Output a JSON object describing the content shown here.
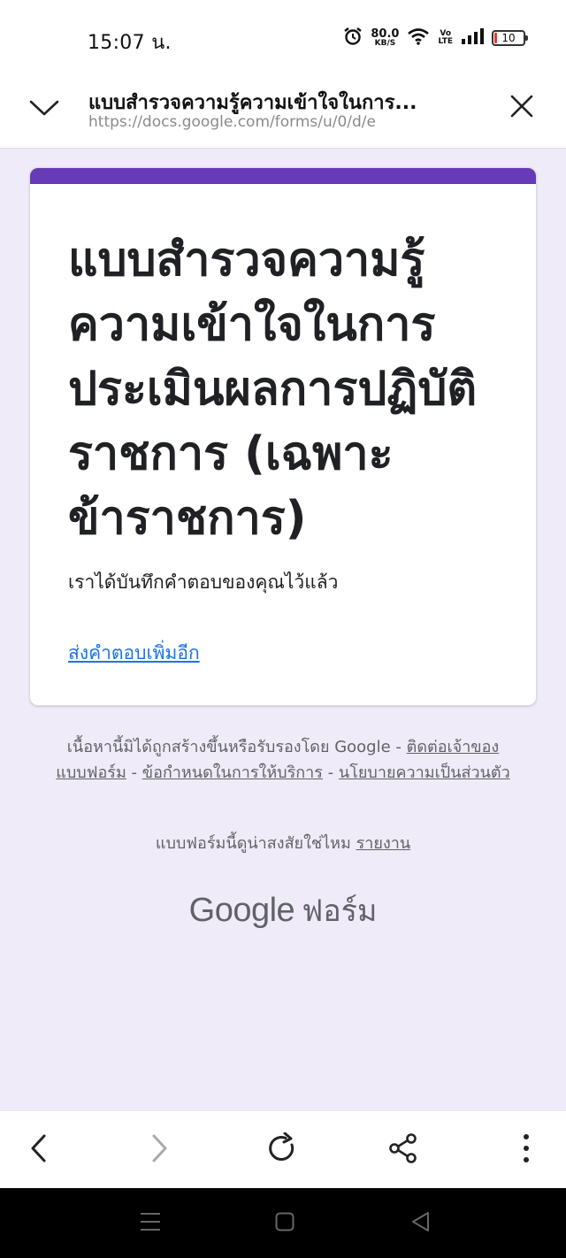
{
  "status_bar": {
    "time": "15:07 น.",
    "net_speed_value": "80.0",
    "net_speed_unit": "KB/S",
    "volte_top": "Vo",
    "volte_bottom": "LTE",
    "battery_level": "10",
    "icons": [
      "alarm-icon",
      "wifi-icon",
      "volte-icon",
      "signal-icon",
      "battery-icon"
    ]
  },
  "browser": {
    "title": "แบบสำรวจความรู้ความเข้าใจในการ...",
    "url": "https://docs.google.com/forms/u/0/d/e",
    "collapse_icon": "chevron-down-icon",
    "close_icon": "close-icon"
  },
  "form": {
    "accent_color": "#673ab7",
    "title": "แบบสำรวจความรู้ความเข้าใจในการประเมินผลการปฏิบัติราชการ (เฉพาะข้าราชการ)",
    "confirmation": "เราได้บันทึกคำตอบของคุณไว้แล้ว",
    "submit_another": "ส่งคำตอบเพิ่มอีก"
  },
  "footer": {
    "disclaimer_text": "เนื้อหานี้มิได้ถูกสร้างขึ้นหรือรับรองโดย Google - ",
    "contact_owner": "ติดต่อเจ้าของแบบฟอร์ม",
    "sep1": " - ",
    "terms": "ข้อกำหนดในการให้บริการ",
    "sep2": " - ",
    "privacy": "นโยบายความเป็นส่วนตัว",
    "suspicious_text": "แบบฟอร์มนี้ดูน่าสงสัยใช่ไหม ",
    "report": "รายงาน",
    "brand_google": "Google",
    "brand_forms": "ฟอร์ม"
  },
  "toolbar": {
    "icons": [
      "back-icon",
      "forward-icon",
      "refresh-icon",
      "share-icon",
      "more-icon"
    ]
  },
  "navigation": {
    "icons": [
      "menu-icon",
      "home-icon",
      "back-triangle-icon"
    ]
  }
}
